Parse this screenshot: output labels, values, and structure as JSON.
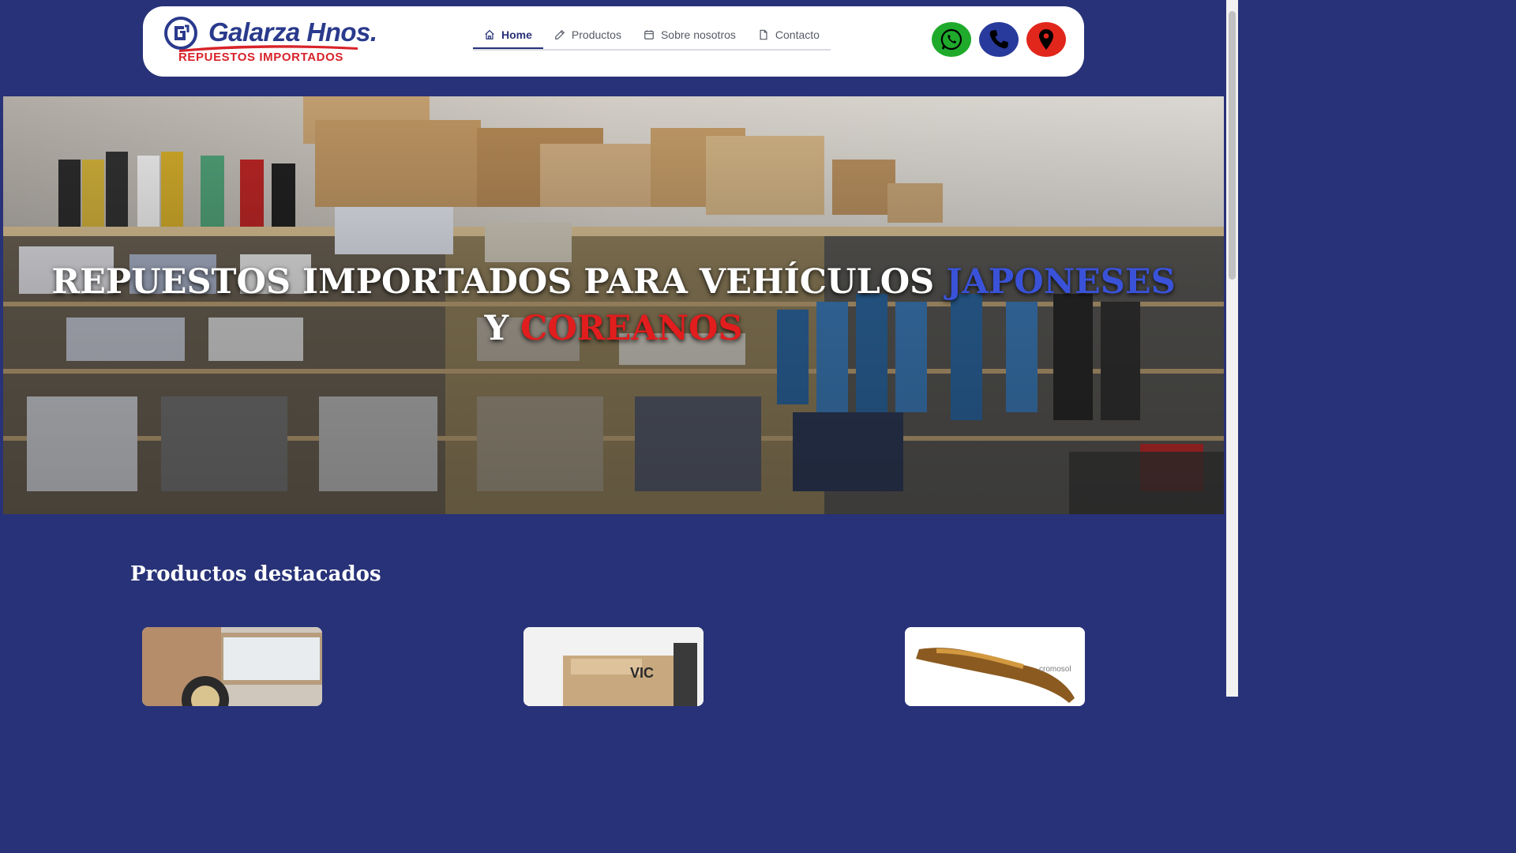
{
  "header": {
    "logo": {
      "brand": "Galarza Hnos.",
      "tagline": "REPUESTOS IMPORTADOS"
    },
    "nav": [
      {
        "label": "Home",
        "icon": "home-icon",
        "active": true
      },
      {
        "label": "Productos",
        "icon": "pencil-icon",
        "active": false
      },
      {
        "label": "Sobre nosotros",
        "icon": "calendar-icon",
        "active": false
      },
      {
        "label": "Contacto",
        "icon": "document-icon",
        "active": false
      }
    ],
    "contact_buttons": [
      {
        "icon": "whatsapp-icon",
        "color": "#1faa2c"
      },
      {
        "icon": "phone-icon",
        "color": "#283a9c"
      },
      {
        "icon": "map-pin-icon",
        "color": "#e1261c"
      }
    ]
  },
  "hero": {
    "title_part1": "REPUESTOS IMPORTADOS PARA VEHÍCULOS ",
    "title_highlight_blue": "JAPONESES",
    "title_part2": "Y ",
    "title_highlight_red": "COREANOS"
  },
  "featured": {
    "title": "Productos destacados",
    "card3_watermark": "cromosol"
  },
  "colors": {
    "background": "#283278",
    "accent_blue": "#3a52d8",
    "accent_red": "#e21d1d"
  }
}
